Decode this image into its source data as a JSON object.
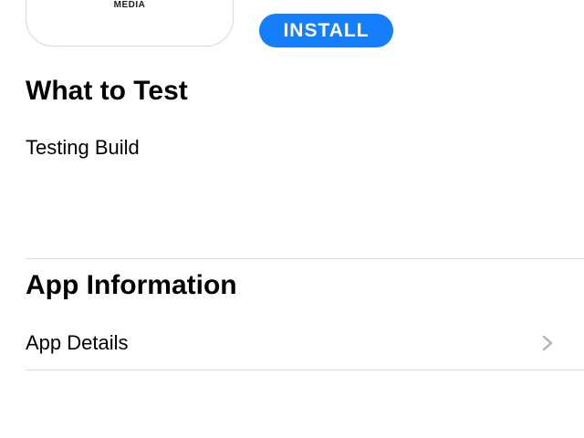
{
  "app_icon": {
    "label": "MEDIA"
  },
  "install_button": {
    "label": "INSTALL",
    "color": "#157efb"
  },
  "what_to_test": {
    "title": "What to Test",
    "body": "Testing Build"
  },
  "app_information": {
    "title": "App Information",
    "rows": [
      {
        "label": "App Details",
        "icon": "chevron-right-icon"
      }
    ]
  }
}
